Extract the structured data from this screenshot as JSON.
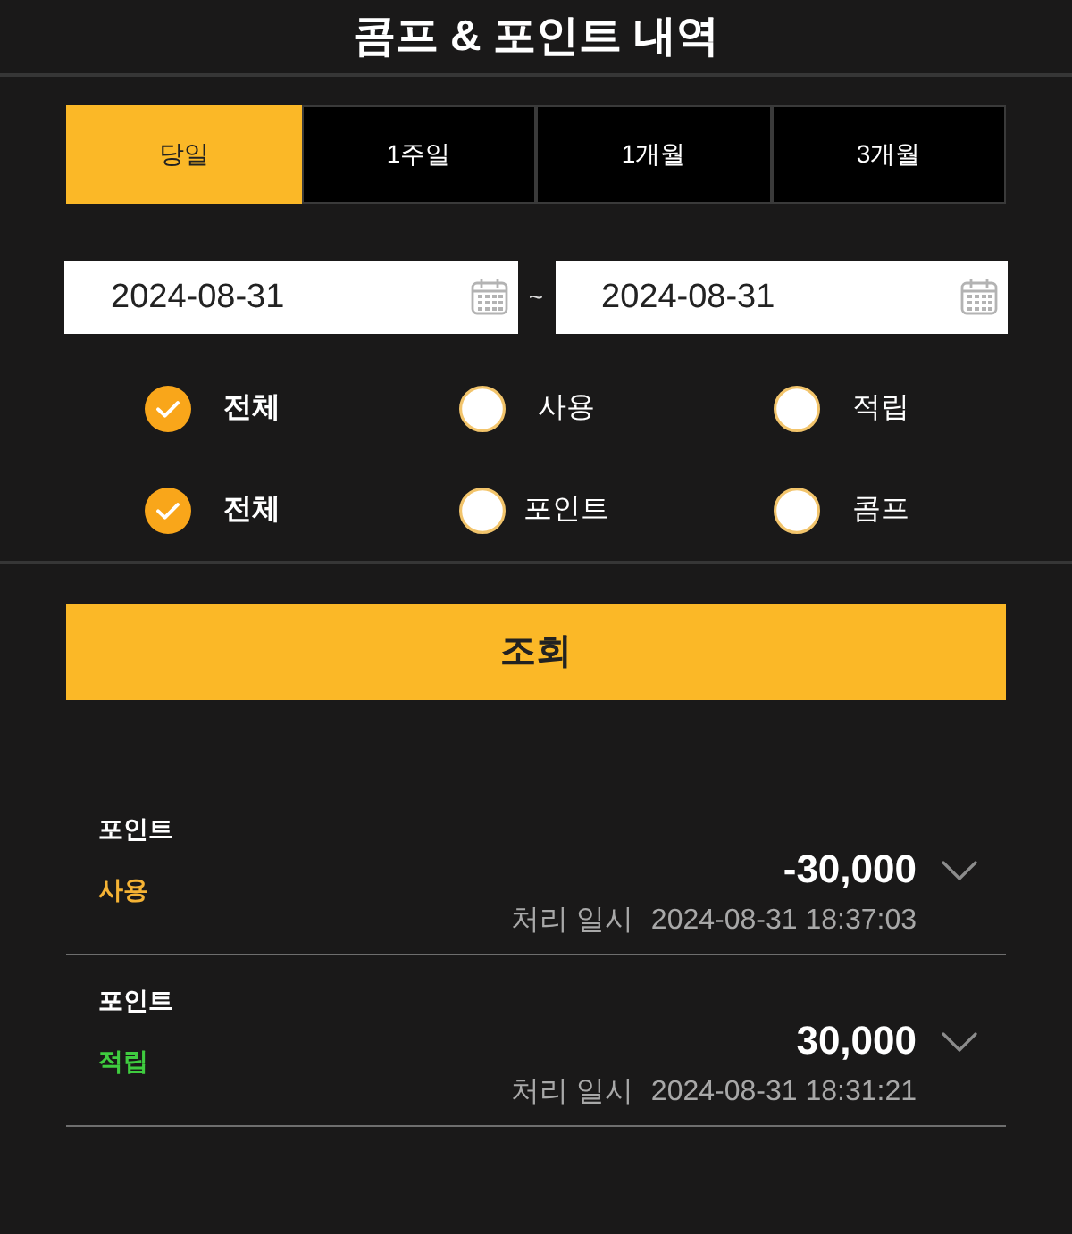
{
  "header": {
    "title": "콤프 & 포인트 내역"
  },
  "period_tabs": [
    {
      "label": "당일",
      "selected": true
    },
    {
      "label": "1주일",
      "selected": false
    },
    {
      "label": "1개월",
      "selected": false
    },
    {
      "label": "3개월",
      "selected": false
    }
  ],
  "date_range": {
    "start": {
      "value": "2024-08-31"
    },
    "separator": "~",
    "end": {
      "value": "2024-08-31"
    }
  },
  "filter_groups": [
    {
      "options": [
        {
          "label": "전체",
          "selected": true
        },
        {
          "label": "사용",
          "selected": false
        },
        {
          "label": "적립",
          "selected": false
        }
      ]
    },
    {
      "options": [
        {
          "label": "전체",
          "selected": true
        },
        {
          "label": "포인트",
          "selected": false
        },
        {
          "label": "콤프",
          "selected": false
        }
      ]
    }
  ],
  "search_button": {
    "label": "조회"
  },
  "history": [
    {
      "category": "포인트",
      "type_label": "사용",
      "color": "#f5b335",
      "amount": "-30,000",
      "expanded": false,
      "date_label": "처리 일시",
      "datetime": "2024-08-31 18:37:03"
    },
    {
      "category": "포인트",
      "type_label": "적립",
      "color": "#3fcc3f",
      "amount": "30,000",
      "expanded": false,
      "date_label": "처리 일시",
      "datetime": "2024-08-31 18:31:21"
    }
  ]
}
